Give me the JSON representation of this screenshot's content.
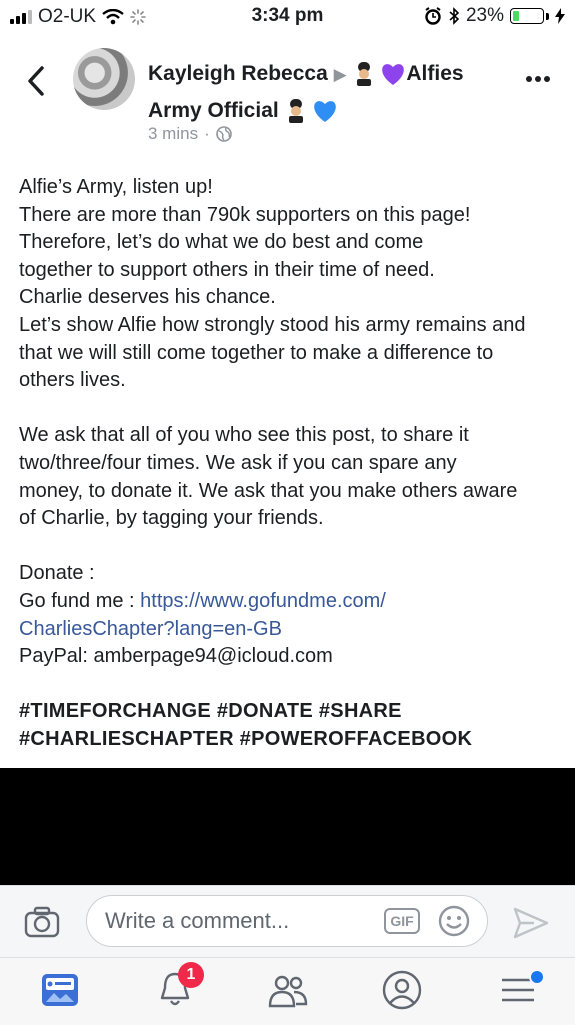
{
  "status_bar": {
    "carrier": "O2-UK",
    "time": "3:34 pm",
    "battery_percent": "23%",
    "battery_level": 0.23
  },
  "post": {
    "author": "Kayleigh Rebecca",
    "page_name_part1": "Alfies",
    "page_name_part2": "Army Official",
    "time_ago": "3 mins",
    "dot": "·",
    "paragraph1": [
      "Alfie’s Army, listen up!",
      "There are more than 790k supporters on this page!",
      "Therefore, let’s do what we do best and come together to support others in their time of need.",
      "Charlie deserves his chance.",
      "Let’s show Alfie how strongly stood his army remains and that we will still come together to make a difference to others lives."
    ],
    "paragraph2": "We ask that all of you who see this post, to share it two/three/four times. We ask if you can spare any money, to donate it. We ask that you make others aware of Charlie, by tagging your friends.",
    "donate_label": "Donate :",
    "gofundme_label": "Go fund me : ",
    "gofundme_link_line1": "https://www.gofundme.com/",
    "gofundme_link_line2": "CharliesChapter?lang=en-GB",
    "paypal": "PayPal: amberpage94@icloud.com",
    "hashtags_line1": "#TIMEFORCHANGE #DONATE #SHARE",
    "hashtags_line2": "#CHARLIESCHAPTER #POWEROFFACEBOOK"
  },
  "composer": {
    "placeholder": "Write a comment...",
    "gif_label": "GIF"
  },
  "tabbar": {
    "notifications_badge": "1",
    "tabs": [
      "news-feed",
      "notifications",
      "friends",
      "profile",
      "menu"
    ]
  },
  "colors": {
    "link": "#385898",
    "badge": "#f02849",
    "battery": "#4cd964",
    "active_tab": "#1877f2"
  }
}
